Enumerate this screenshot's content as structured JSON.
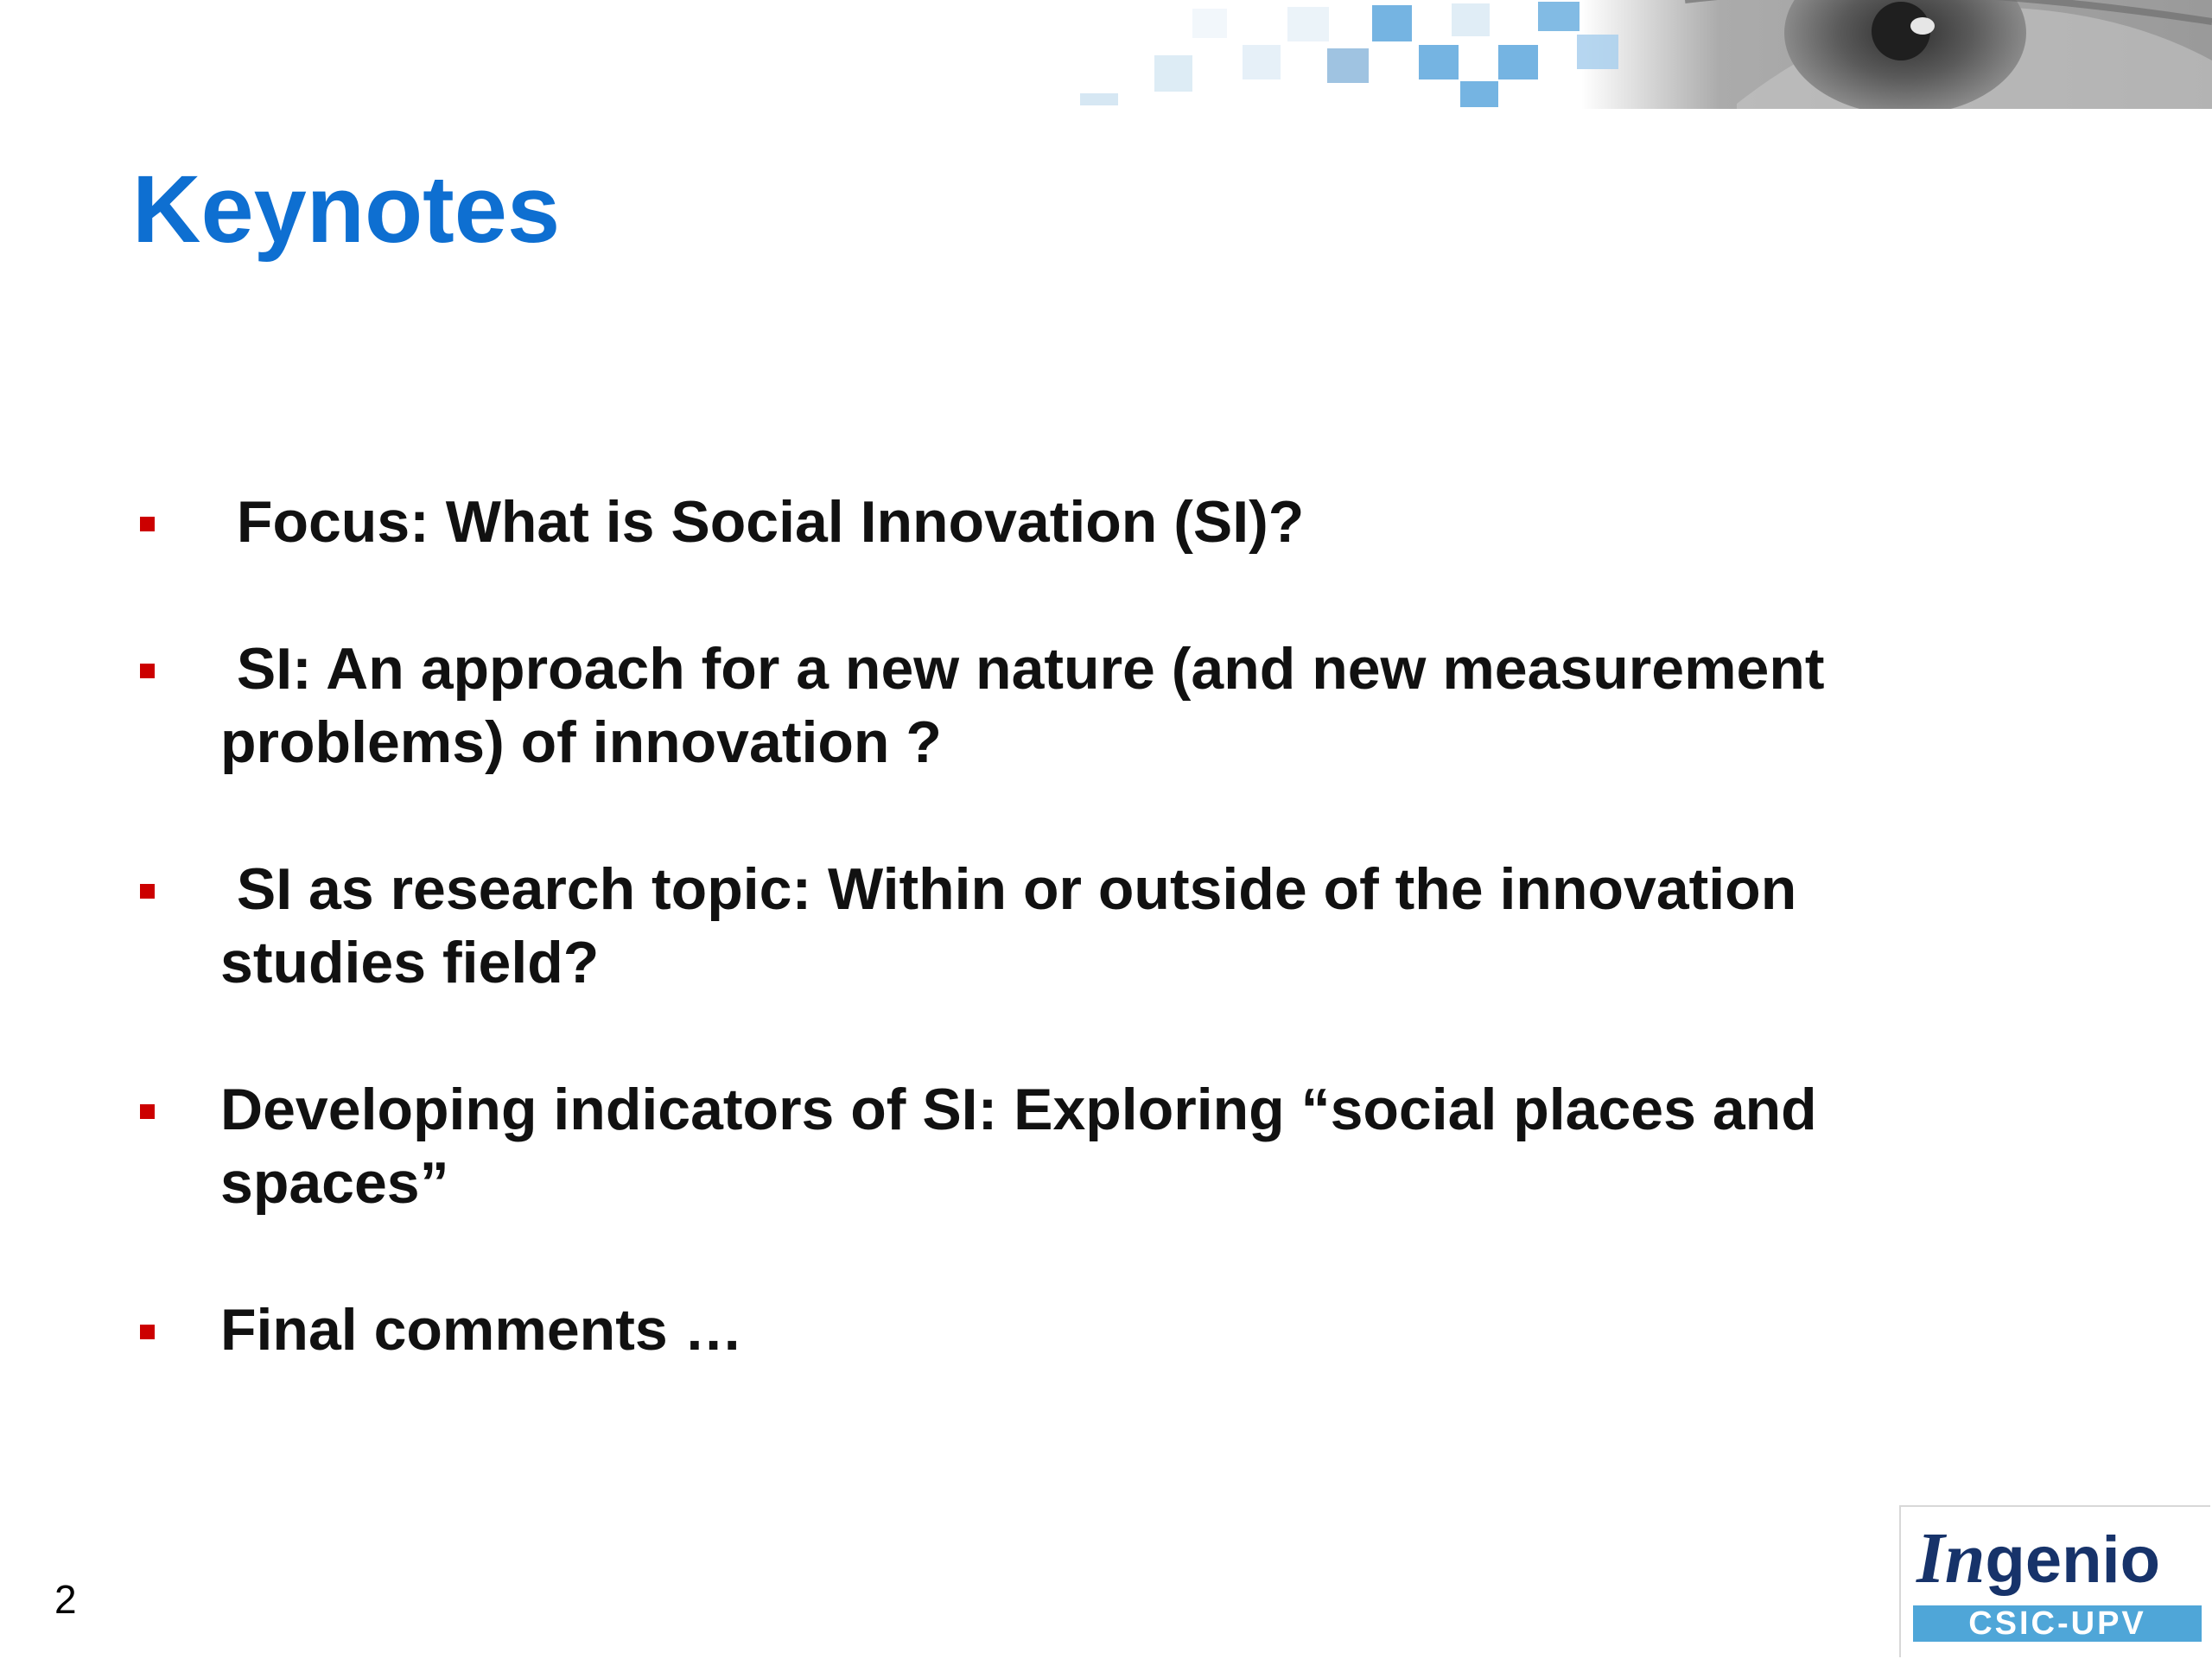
{
  "slide": {
    "title": "Keynotes",
    "bullets": [
      {
        "label": " Focus: What is Social Innovation (SI)?"
      },
      {
        "label": " SI: An approach for a new nature (and new measurement problems) of innovation ?"
      },
      {
        "label": " SI as research topic: Within or outside of the innovation studies field?"
      },
      {
        "label": "Developing indicators of SI: Exploring “social places and spaces”"
      },
      {
        "label": "Final comments …"
      }
    ],
    "page_number": "2"
  },
  "logo": {
    "name": "Ingenio",
    "subtitle": "CSIC-UPV"
  },
  "colors": {
    "title": "#0e6fd1",
    "bullet_marker": "#cc0000",
    "body_text": "#111111",
    "logo_text": "#17336a",
    "logo_band": "#4fa6d8"
  },
  "icons": {
    "banner": "eye-banner-icon",
    "bullet": "square-bullet-icon"
  }
}
